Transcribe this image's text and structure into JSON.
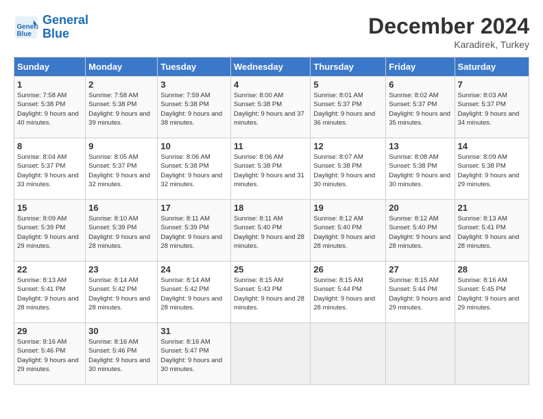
{
  "header": {
    "logo_line1": "General",
    "logo_line2": "Blue",
    "month": "December 2024",
    "location": "Karadirek, Turkey"
  },
  "weekdays": [
    "Sunday",
    "Monday",
    "Tuesday",
    "Wednesday",
    "Thursday",
    "Friday",
    "Saturday"
  ],
  "weeks": [
    [
      {
        "day": "1",
        "sunrise": "7:58 AM",
        "sunset": "5:38 PM",
        "daylight": "9 hours and 40 minutes."
      },
      {
        "day": "2",
        "sunrise": "7:58 AM",
        "sunset": "5:38 PM",
        "daylight": "9 hours and 39 minutes."
      },
      {
        "day": "3",
        "sunrise": "7:59 AM",
        "sunset": "5:38 PM",
        "daylight": "9 hours and 38 minutes."
      },
      {
        "day": "4",
        "sunrise": "8:00 AM",
        "sunset": "5:38 PM",
        "daylight": "9 hours and 37 minutes."
      },
      {
        "day": "5",
        "sunrise": "8:01 AM",
        "sunset": "5:37 PM",
        "daylight": "9 hours and 36 minutes."
      },
      {
        "day": "6",
        "sunrise": "8:02 AM",
        "sunset": "5:37 PM",
        "daylight": "9 hours and 35 minutes."
      },
      {
        "day": "7",
        "sunrise": "8:03 AM",
        "sunset": "5:37 PM",
        "daylight": "9 hours and 34 minutes."
      }
    ],
    [
      {
        "day": "8",
        "sunrise": "8:04 AM",
        "sunset": "5:37 PM",
        "daylight": "9 hours and 33 minutes."
      },
      {
        "day": "9",
        "sunrise": "8:05 AM",
        "sunset": "5:37 PM",
        "daylight": "9 hours and 32 minutes."
      },
      {
        "day": "10",
        "sunrise": "8:06 AM",
        "sunset": "5:38 PM",
        "daylight": "9 hours and 32 minutes."
      },
      {
        "day": "11",
        "sunrise": "8:06 AM",
        "sunset": "5:38 PM",
        "daylight": "9 hours and 31 minutes."
      },
      {
        "day": "12",
        "sunrise": "8:07 AM",
        "sunset": "5:38 PM",
        "daylight": "9 hours and 30 minutes."
      },
      {
        "day": "13",
        "sunrise": "8:08 AM",
        "sunset": "5:38 PM",
        "daylight": "9 hours and 30 minutes."
      },
      {
        "day": "14",
        "sunrise": "8:09 AM",
        "sunset": "5:38 PM",
        "daylight": "9 hours and 29 minutes."
      }
    ],
    [
      {
        "day": "15",
        "sunrise": "8:09 AM",
        "sunset": "5:39 PM",
        "daylight": "9 hours and 29 minutes."
      },
      {
        "day": "16",
        "sunrise": "8:10 AM",
        "sunset": "5:39 PM",
        "daylight": "9 hours and 28 minutes."
      },
      {
        "day": "17",
        "sunrise": "8:11 AM",
        "sunset": "5:39 PM",
        "daylight": "9 hours and 28 minutes."
      },
      {
        "day": "18",
        "sunrise": "8:11 AM",
        "sunset": "5:40 PM",
        "daylight": "9 hours and 28 minutes."
      },
      {
        "day": "19",
        "sunrise": "8:12 AM",
        "sunset": "5:40 PM",
        "daylight": "9 hours and 28 minutes."
      },
      {
        "day": "20",
        "sunrise": "8:12 AM",
        "sunset": "5:40 PM",
        "daylight": "9 hours and 28 minutes."
      },
      {
        "day": "21",
        "sunrise": "8:13 AM",
        "sunset": "5:41 PM",
        "daylight": "9 hours and 28 minutes."
      }
    ],
    [
      {
        "day": "22",
        "sunrise": "8:13 AM",
        "sunset": "5:41 PM",
        "daylight": "9 hours and 28 minutes."
      },
      {
        "day": "23",
        "sunrise": "8:14 AM",
        "sunset": "5:42 PM",
        "daylight": "9 hours and 28 minutes."
      },
      {
        "day": "24",
        "sunrise": "8:14 AM",
        "sunset": "5:42 PM",
        "daylight": "9 hours and 28 minutes."
      },
      {
        "day": "25",
        "sunrise": "8:15 AM",
        "sunset": "5:43 PM",
        "daylight": "9 hours and 28 minutes."
      },
      {
        "day": "26",
        "sunrise": "8:15 AM",
        "sunset": "5:44 PM",
        "daylight": "9 hours and 28 minutes."
      },
      {
        "day": "27",
        "sunrise": "8:15 AM",
        "sunset": "5:44 PM",
        "daylight": "9 hours and 29 minutes."
      },
      {
        "day": "28",
        "sunrise": "8:16 AM",
        "sunset": "5:45 PM",
        "daylight": "9 hours and 29 minutes."
      }
    ],
    [
      {
        "day": "29",
        "sunrise": "8:16 AM",
        "sunset": "5:46 PM",
        "daylight": "9 hours and 29 minutes."
      },
      {
        "day": "30",
        "sunrise": "8:16 AM",
        "sunset": "5:46 PM",
        "daylight": "9 hours and 30 minutes."
      },
      {
        "day": "31",
        "sunrise": "8:16 AM",
        "sunset": "5:47 PM",
        "daylight": "9 hours and 30 minutes."
      },
      null,
      null,
      null,
      null
    ]
  ]
}
